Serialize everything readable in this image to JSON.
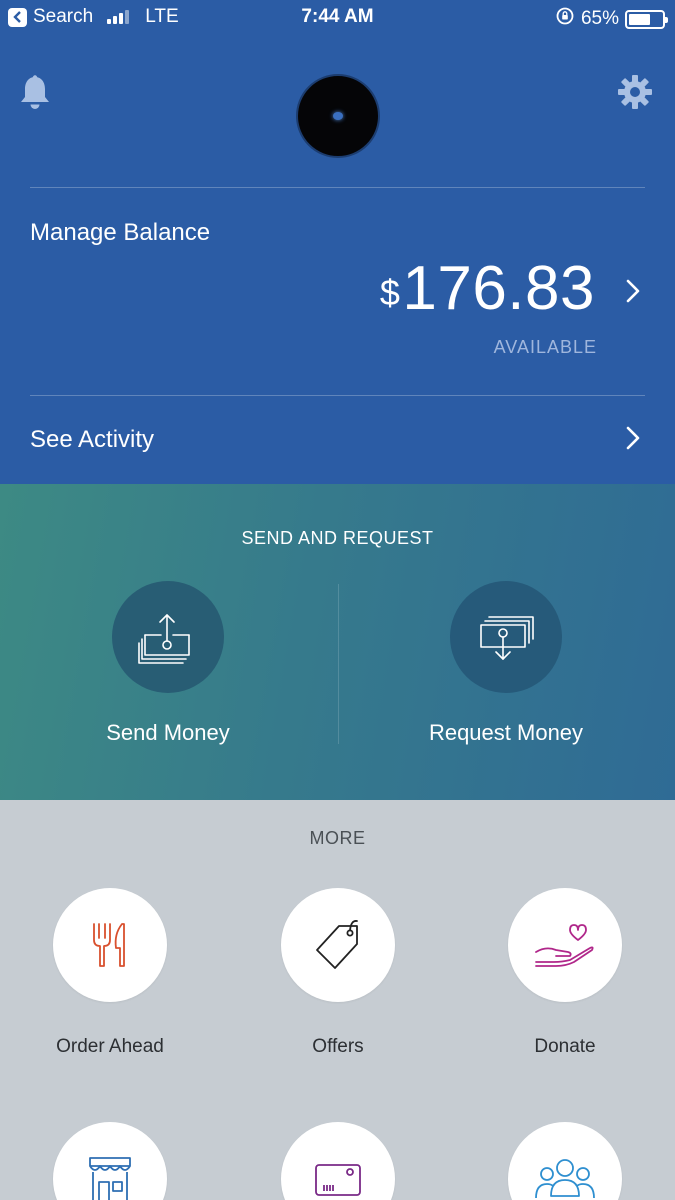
{
  "status_bar": {
    "back_label": "Search",
    "carrier": "LTE",
    "time": "7:44 AM",
    "battery": "65%",
    "battery_level": 0.65
  },
  "header": {
    "bell_icon": "bell-icon",
    "settings_icon": "gear-icon",
    "avatar_icon": "avatar"
  },
  "balance": {
    "manage_label": "Manage Balance",
    "currency_symbol": "$",
    "amount": "176.83",
    "available_label": "AVAILABLE"
  },
  "activity": {
    "label": "See Activity"
  },
  "send_request": {
    "title": "SEND AND REQUEST",
    "send_label": "Send Money",
    "request_label": "Request Money"
  },
  "more": {
    "title": "MORE",
    "items": [
      {
        "label": "Order Ahead",
        "icon": "fork-knife-icon",
        "color": "#d9502e"
      },
      {
        "label": "Offers",
        "icon": "tag-icon",
        "color": "#222222"
      },
      {
        "label": "Donate",
        "icon": "hand-heart-icon",
        "color": "#b0278a"
      },
      {
        "label": "",
        "icon": "storefront-icon",
        "color": "#2e6fb3"
      },
      {
        "label": "",
        "icon": "card-icon",
        "color": "#7a2a87"
      },
      {
        "label": "",
        "icon": "people-icon",
        "color": "#2e8fd0"
      }
    ]
  },
  "colors": {
    "header_blue": "#2b5ca5",
    "gradient_start": "#3d8a84",
    "gradient_end": "#2f6b95",
    "more_bg": "#c6ccd2"
  }
}
